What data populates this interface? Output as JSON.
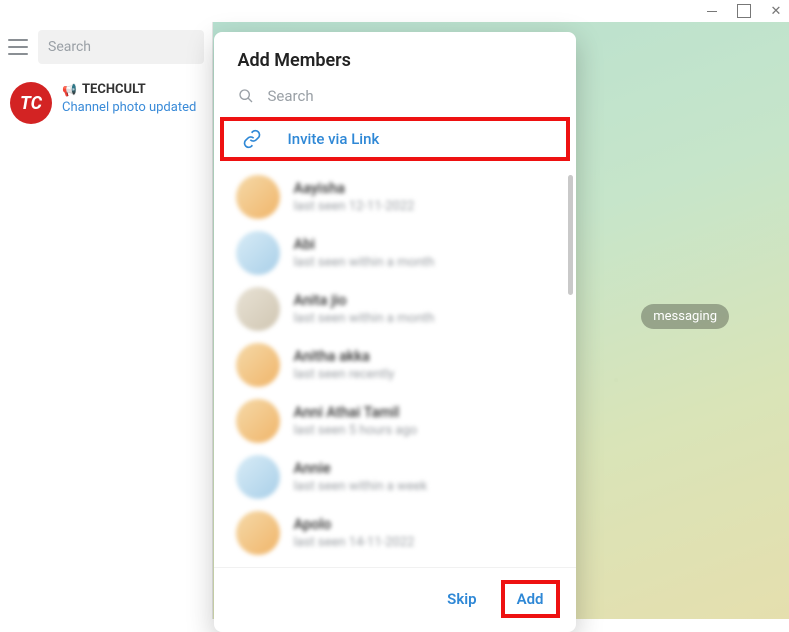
{
  "window": {
    "minimize": "–",
    "maximize": "☐",
    "close": "✕"
  },
  "sidebar": {
    "search_placeholder": "Search",
    "channel": {
      "avatar_text": "TC",
      "title": "TECHCULT",
      "subtitle": "Channel photo updated"
    }
  },
  "chat": {
    "hint_badge": "messaging"
  },
  "modal": {
    "title": "Add Members",
    "search_placeholder": "Search",
    "invite_link_label": "Invite via Link",
    "contacts": [
      {
        "name": "Aayisha",
        "status": "last seen 12-11-2022"
      },
      {
        "name": "Abi",
        "status": "last seen within a month"
      },
      {
        "name": "Anita jio",
        "status": "last seen within a month"
      },
      {
        "name": "Anitha akka",
        "status": "last seen recently"
      },
      {
        "name": "Anni Athai Tamil",
        "status": "last seen 5 hours ago"
      },
      {
        "name": "Annie",
        "status": "last seen within a week"
      },
      {
        "name": "Apolo",
        "status": "last seen 14-11-2022"
      }
    ],
    "actions": {
      "skip": "Skip",
      "add": "Add"
    }
  },
  "highlight_color": "#e11"
}
